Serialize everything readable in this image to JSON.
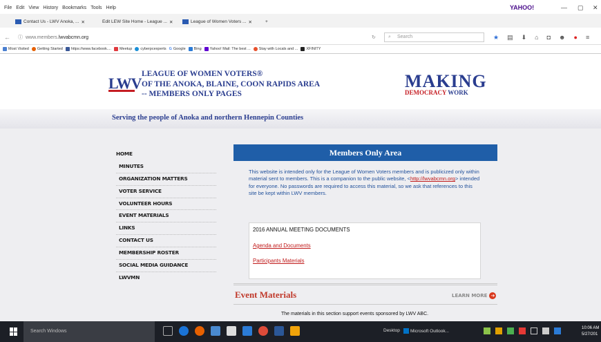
{
  "browser": {
    "menus": [
      "File",
      "Edit",
      "View",
      "History",
      "Bookmarks",
      "Tools",
      "Help"
    ],
    "yahoo_logo": "YAHOO!",
    "tabs": [
      {
        "label": "Contact Us - LWV Anoka, ..."
      },
      {
        "label": "Edit LEW Site Home - League ..."
      },
      {
        "label": "League of Women Voters ..."
      }
    ],
    "url_prefix": "www.members.",
    "url_domain": "lwvabcmn.org",
    "search_placeholder": "Search",
    "bookmarks": [
      "Most Visited",
      "Getting Started",
      "https://www.facebook....",
      "Meetup",
      "cyberpcexperts",
      "Google",
      "Bing",
      "Yahoo! Mail: The best ...",
      "Stay with Locals and ...",
      "XFINITY"
    ]
  },
  "site": {
    "logo_letters": "LWV",
    "org_line1": "LEAGUE OF WOMEN VOTERS®",
    "org_line2": "OF THE ANOKA, BLAINE, COON RAPIDS AREA",
    "org_line3": "-- MEMBERS ONLY PAGES",
    "making": "MAKING",
    "democracy": "DEMOCRACY",
    "work": "WORK",
    "tagline": "Serving the people of Anoka and northern Hennepin Counties"
  },
  "nav": [
    "HOME",
    "MINUTES",
    "ORGANIZATION MATTERS",
    "VOTER SERVICE",
    "VOLUNTEER HOURS",
    "EVENT MATERIALS",
    "LINKS",
    "CONTACT US",
    "MEMBERSHIP ROSTER",
    "SOCIAL MEDIA GUIDANCE",
    "LWVMN"
  ],
  "main": {
    "heading": "Members Only Area",
    "intro_before": "This website is intended only for the League of Women Voters members and is publicized only within material sent to members. This is a companion to the public website, <",
    "intro_link": "http://lwvabcmn.org",
    "intro_after": "> intended for everyone. No passwords are required to access this material, so we ask that references to this site be kept within LWV members.",
    "doc_title": "2016 ANNUAL MEETING DOCUMENTS",
    "doc_link1": "Agenda and Documents",
    "doc_link2": "Participants Materials"
  },
  "events": {
    "title": "Event Materials",
    "learn_more": "LEARN MORE",
    "text": "The materials in this section support events sponsored by LWV ABC."
  },
  "taskbar": {
    "search": "Search Windows",
    "desktop": "Desktop",
    "outlook": "Microsoft Outlook...",
    "time": "10:06 AM",
    "date": "5/27/201"
  }
}
